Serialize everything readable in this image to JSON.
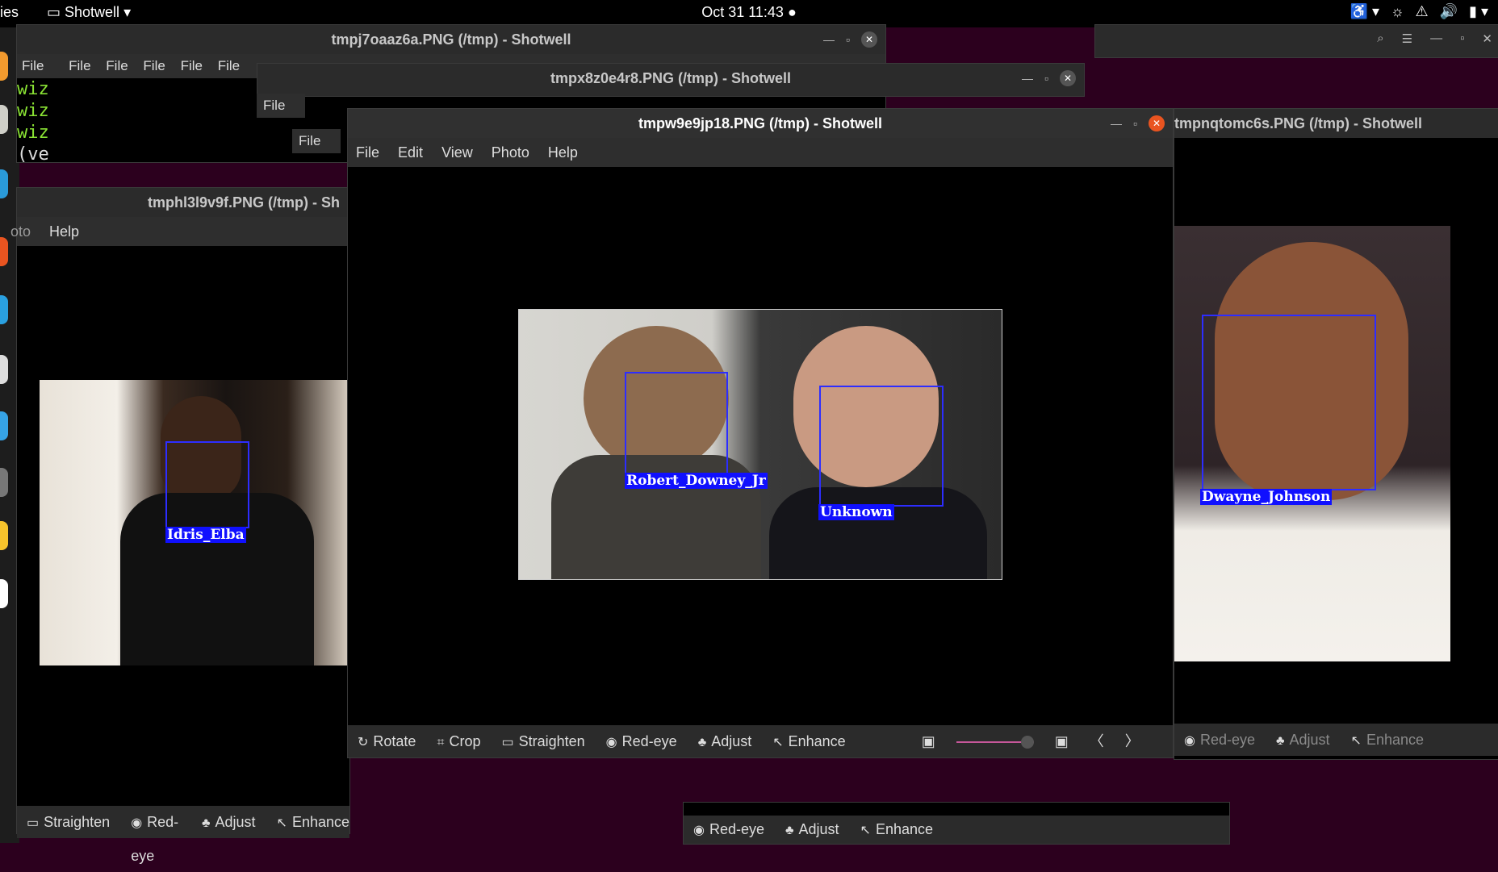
{
  "topbar": {
    "activities": "ies",
    "app": "Shotwell",
    "clock": "Oct 31  11:43",
    "dot": "●"
  },
  "windows": {
    "w1_title": "tmpj7oaaz6a.PNG (/tmp) - Shotwell",
    "w2_title": "tmpx8z0e4r8.PNG (/tmp) - Shotwell",
    "main_title": "tmpw9e9jp18.PNG (/tmp) - Shotwell",
    "left_title": "tmphl3l9v9f.PNG (/tmp) - Sh",
    "right_title": "tmpnqtomc6s.PNG (/tmp) - Shotwell"
  },
  "file_menus": [
    "File",
    "File",
    "File",
    "File",
    "File",
    "File",
    "File",
    "File"
  ],
  "terminal": [
    "wiz",
    "wiz",
    "wiz",
    "(ve"
  ],
  "main_menu": [
    "File",
    "Edit",
    "View",
    "Photo",
    "Help"
  ],
  "left_menu": [
    "oto",
    "Help"
  ],
  "main_toolbar": [
    "Rotate",
    "Crop",
    "Straighten",
    "Red-eye",
    "Adjust",
    "Enhance"
  ],
  "left_toolbar": [
    "Straighten",
    "Red-eye",
    "Adjust",
    "Enhance"
  ],
  "right_toolbar": [
    "Red-eye",
    "Adjust",
    "Enhance"
  ],
  "bottom_toolbar": [
    "Red-eye",
    "Adjust",
    "Enhance"
  ],
  "faces": {
    "rdj": "Robert_Downey_Jr",
    "unknown": "Unknown",
    "idris": "Idris_Elba",
    "dwayne": "Dwayne_Johnson"
  },
  "colors": {
    "accent": "#e95420",
    "facebox": "#1010ff"
  }
}
